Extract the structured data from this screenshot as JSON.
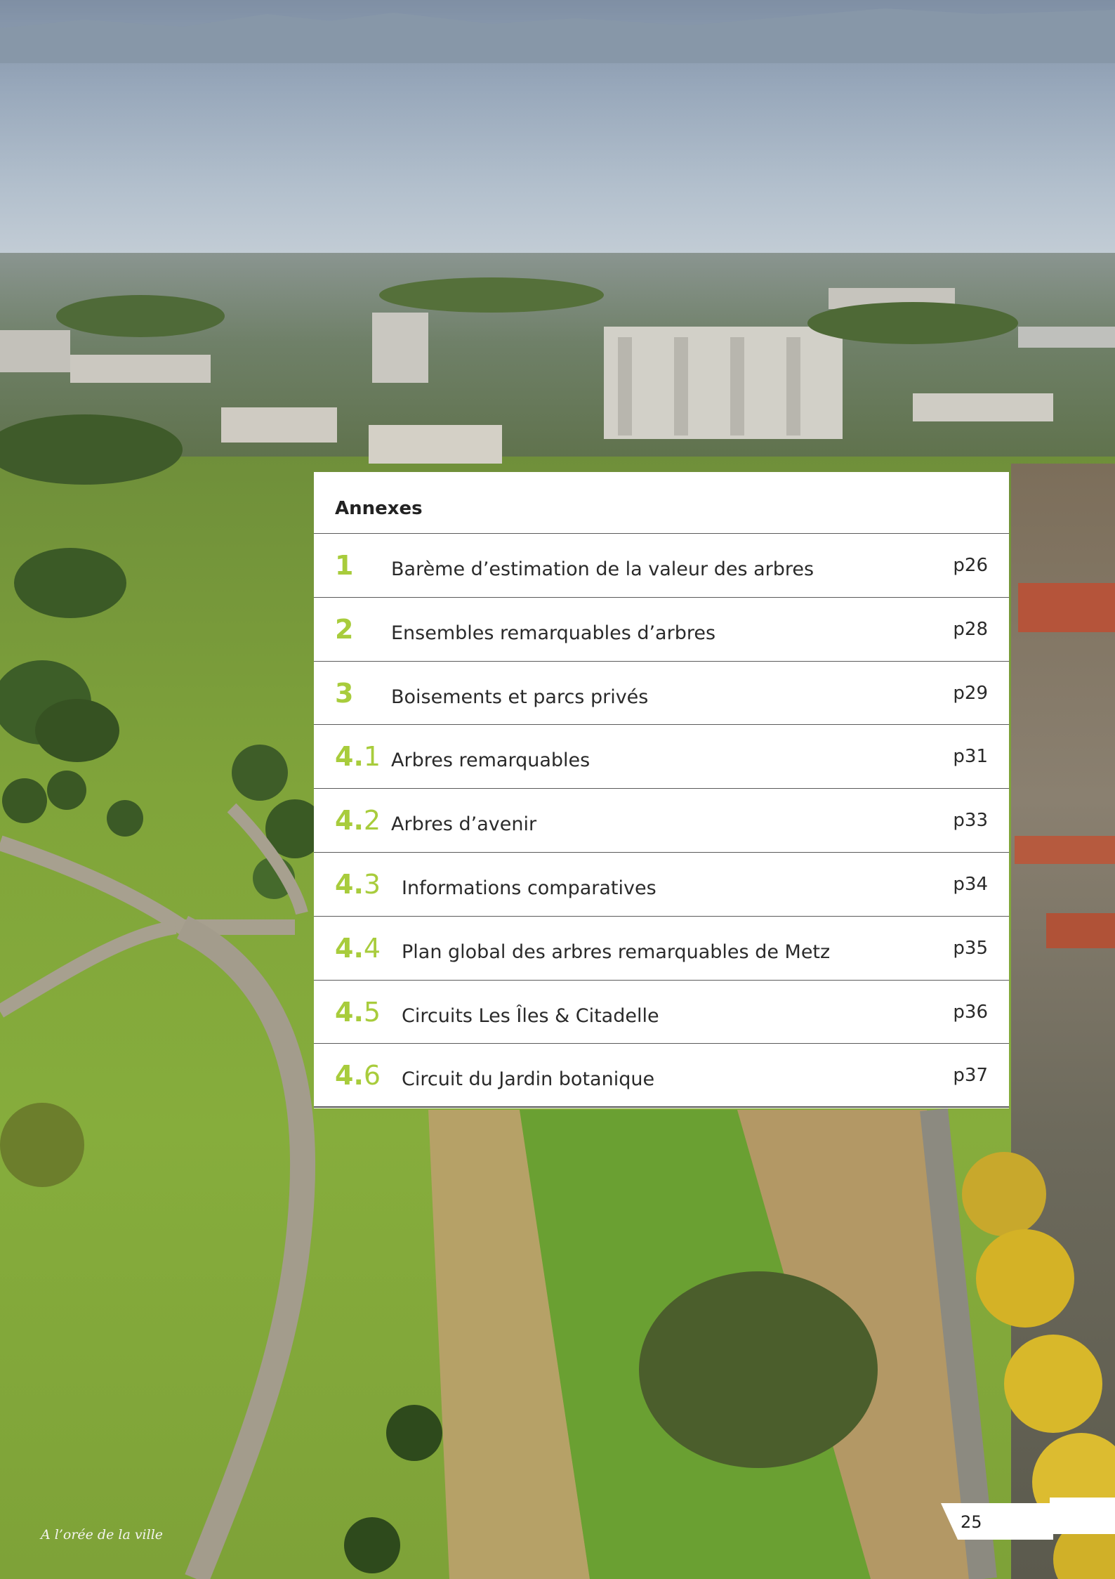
{
  "toc": {
    "title": "Annexes",
    "entries": [
      {
        "num_main": "1",
        "num_sub": "",
        "label": "Barème d’estimation de la valeur des arbres",
        "page": "p26"
      },
      {
        "num_main": "2",
        "num_sub": "",
        "label": "Ensembles remarquables d’arbres",
        "page": "p28"
      },
      {
        "num_main": "3",
        "num_sub": "",
        "label": "Boisements et parcs privés",
        "page": "p29"
      },
      {
        "num_main": "4.",
        "num_sub": "1",
        "label": "Arbres remarquables",
        "page": "p31"
      },
      {
        "num_main": "4.",
        "num_sub": "2",
        "label": "Arbres d’avenir",
        "page": "p33"
      },
      {
        "num_main": "4.",
        "num_sub": "3",
        "label": "Informations comparatives",
        "page": "p34"
      },
      {
        "num_main": "4.",
        "num_sub": "4",
        "label": "Plan global des arbres remarquables de Metz",
        "page": "p35"
      },
      {
        "num_main": "4.",
        "num_sub": "5",
        "label": "Circuits Les Îles & Citadelle",
        "page": "p36"
      },
      {
        "num_main": "4.",
        "num_sub": "6",
        "label": "Circuit du Jardin botanique",
        "page": "p37"
      }
    ]
  },
  "footer": {
    "publication": "A l’orée de la ville",
    "page_number": "25"
  },
  "colors": {
    "accent": "#a8cc3c",
    "text": "#2a2a2a"
  }
}
